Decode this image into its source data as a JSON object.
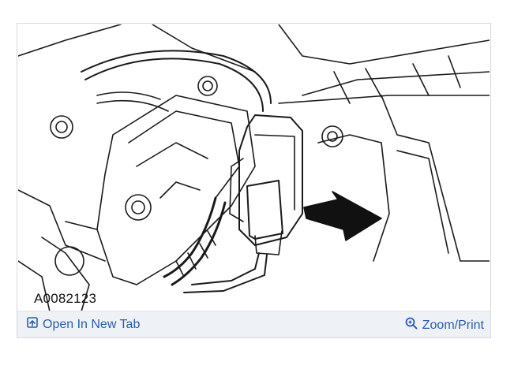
{
  "figure": {
    "id_label": "A0082123"
  },
  "footer": {
    "open_tab_label": "Open In New Tab",
    "open_tab_icon": "open-new-tab-icon",
    "zoom_label": "Zoom/Print",
    "zoom_icon": "magnifier-zoom-icon"
  },
  "colors": {
    "link": "#2a5db0",
    "footer_bg": "#eef1f6",
    "border": "#d6d9de"
  }
}
